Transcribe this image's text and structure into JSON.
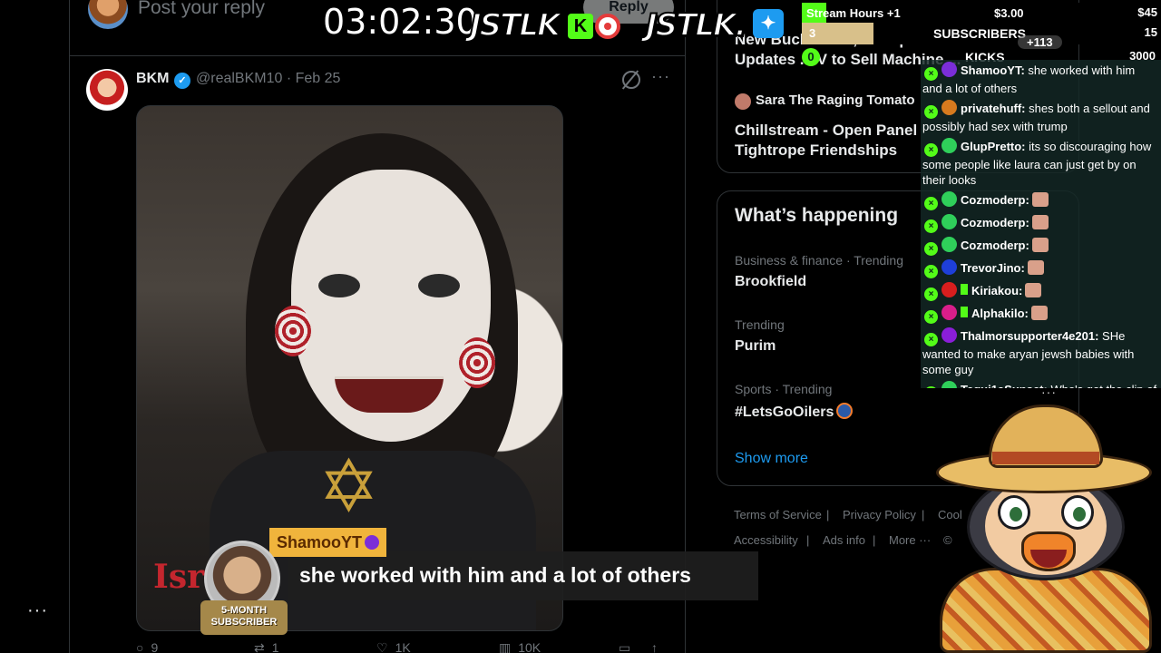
{
  "compose": {
    "placeholder": "Post your reply",
    "reply_label": "Reply"
  },
  "post": {
    "name": "BKM",
    "handle": "@realBKM10 · Feb 25",
    "more": "···",
    "image_overlay_text": "Isr",
    "actions": [
      "9",
      "1",
      "1K",
      "10K"
    ]
  },
  "rail": {
    "more": "···"
  },
  "top_card": {
    "line1": "New Buck... suit, Trump",
    "line2": "Updates ... V to Sell Machine ...",
    "author": "Sara The Raging Tomato",
    "headline1": "Chillstream - Open Panel",
    "headline2": "Tightrope Friendships"
  },
  "happening": {
    "title": "What’s happening",
    "trends": [
      {
        "meta": "Business & finance · Trending",
        "name": "Brookfield"
      },
      {
        "meta": "Trending",
        "name": "Purim"
      },
      {
        "meta": "Sports · Trending",
        "name": "#LetsGoOilers"
      }
    ],
    "show_more": "Show more"
  },
  "footer": {
    "terms": "Terms of Service",
    "privacy": "Privacy Policy",
    "cookie": "Cool",
    "accessibility": "Accessibility",
    "ads": "Ads info",
    "more": "More ···",
    "copyright": "©"
  },
  "overlay": {
    "timer": "03:02:30",
    "brand": "JSTLK",
    "brand2": "JSTLK.",
    "k_badge": "K",
    "goals": {
      "hours_label": "Stream Hours +1",
      "hours_amount": "$3.00",
      "hours_total": "$45",
      "hours_progress": 0.067,
      "subs_count": "3",
      "subs_label": "SUBSCRIBERS",
      "subs_total": "15",
      "subs_progress": 0.2,
      "kicks_count": "0",
      "kicks_label": "KICKS",
      "kicks_total": "3000",
      "kicks_progress": 0.0,
      "viewer_bubble": "+113"
    }
  },
  "chat": {
    "messages": [
      {
        "user": "ShamooYT:",
        "text": " she worked with him and a lot of others",
        "color": "#7b2ed8"
      },
      {
        "user": "privatehuff:",
        "text": " shes both a sellout and possibly had sex with trump",
        "color": "#d77a1e"
      },
      {
        "user": "GlupPretto:",
        "text": " its so discouraging how some people like laura can just get by on their looks",
        "color": "#2fcf5a"
      },
      {
        "user": "Cozmoderp:",
        "text": "",
        "color": "#2fcf5a"
      },
      {
        "user": "Cozmoderp:",
        "text": "",
        "color": "#2fcf5a"
      },
      {
        "user": "Cozmoderp:",
        "text": "",
        "color": "#2fcf5a"
      },
      {
        "user": "TrevorJino:",
        "text": "",
        "color": "#1e3fd8"
      },
      {
        "user": "Kiriakou:",
        "text": "",
        "color": "#d81e1e"
      },
      {
        "user": "Alphakilo:",
        "text": "",
        "color": "#d81e8a"
      },
      {
        "user": "Thalmorsupporter4e201:",
        "text": " SHe wanted to make aryan jewsh babies with some guy",
        "color": "#8a1ed8"
      },
      {
        "user": "Tequi1aSunset:",
        "text": " Who's got the clip of her tryna fuck that aryan dude",
        "color": "#2fcf5a"
      }
    ],
    "more": "···"
  },
  "alert": {
    "username": "ShamooYT",
    "message": "she worked with him and a lot of others",
    "sub_badge_line1": "5-MONTH",
    "sub_badge_line2": "SUBSCRIBER"
  },
  "colors": {
    "kick_green": "#53fc18",
    "x_blue": "#1d9bf0",
    "alert_gold": "#f0b43c"
  }
}
